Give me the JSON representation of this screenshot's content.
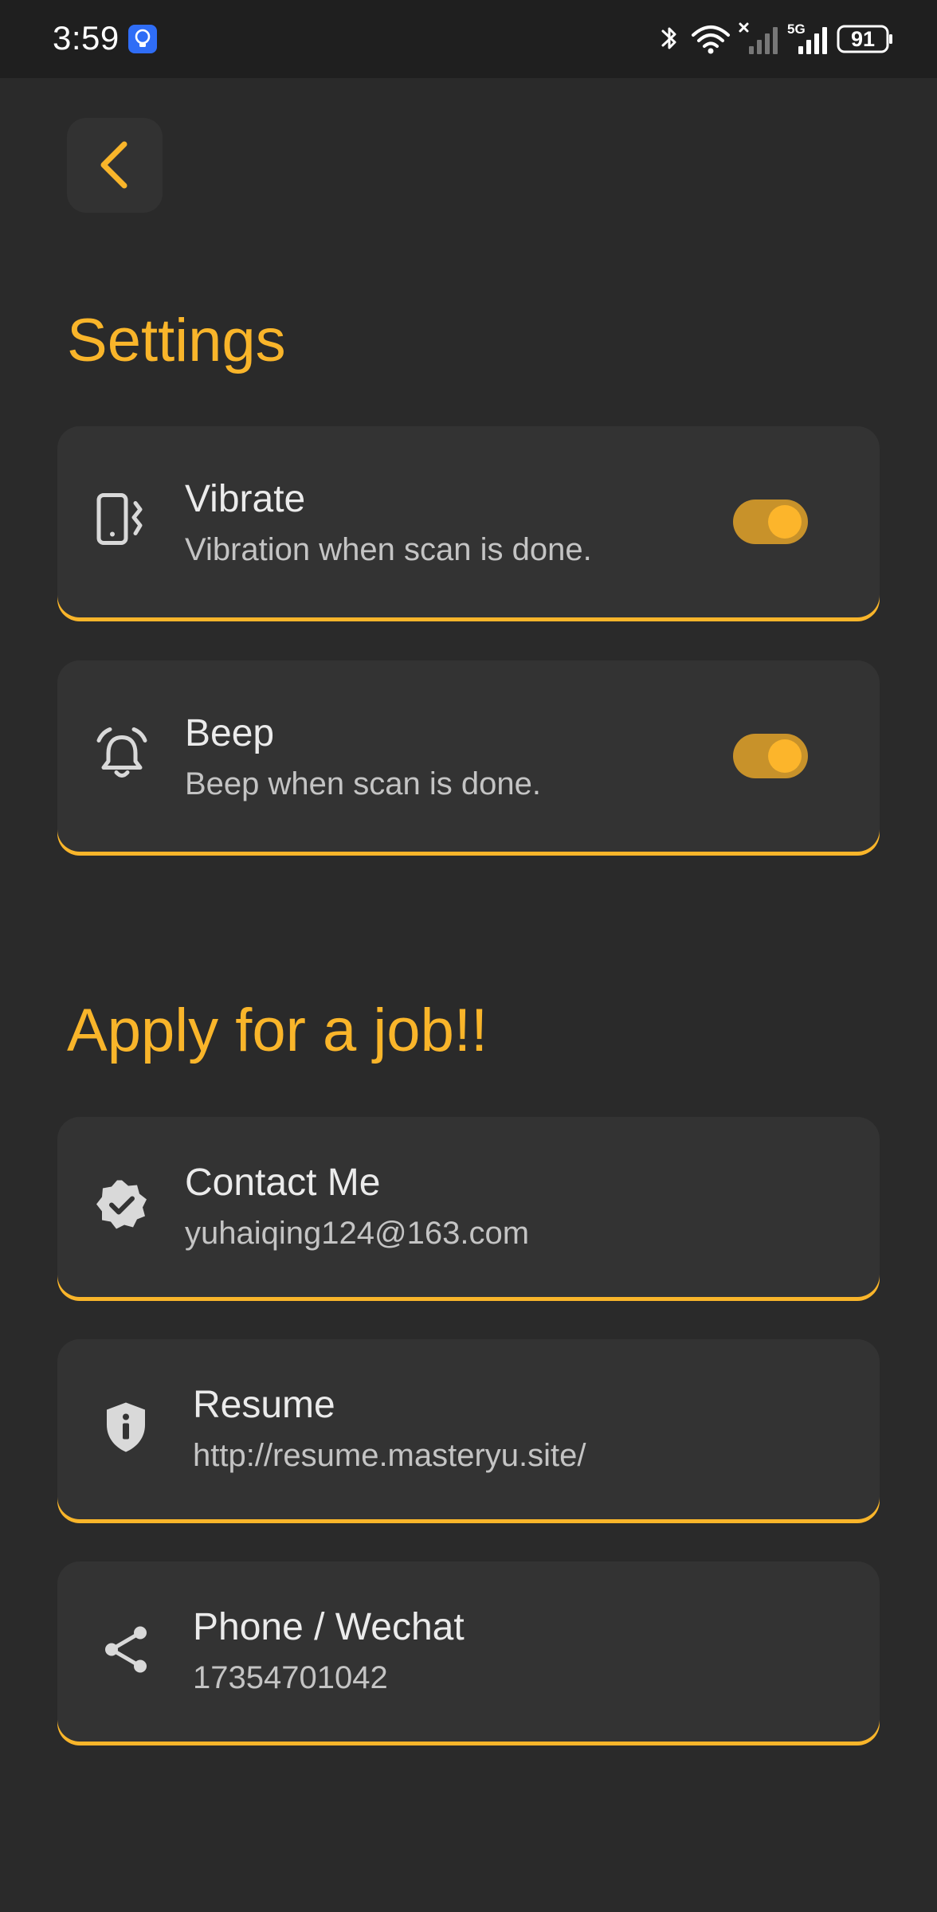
{
  "status_bar": {
    "time": "3:59",
    "battery": "91",
    "signal_label": "5G",
    "icons": [
      "app-notification-icon",
      "bluetooth-icon",
      "wifi-icon",
      "signal-off-icon",
      "signal-5g-icon",
      "battery-icon"
    ]
  },
  "nav": {
    "back_icon": "chevron-left-icon"
  },
  "settings": {
    "title": "Settings",
    "items": [
      {
        "icon": "phone-vibrate-icon",
        "title": "Vibrate",
        "subtitle": "Vibration when scan is done.",
        "enabled": true
      },
      {
        "icon": "alarm-bell-icon",
        "title": "Beep",
        "subtitle": "Beep when scan is done.",
        "enabled": true
      }
    ]
  },
  "apply": {
    "title": "Apply for a job!!",
    "items": [
      {
        "icon": "verified-badge-icon",
        "title": "Contact Me",
        "subtitle": "yuhaiqing124@163.com"
      },
      {
        "icon": "info-shield-icon",
        "title": "Resume",
        "subtitle": "http://resume.masteryu.site/"
      },
      {
        "icon": "share-icon",
        "title": "Phone / Wechat",
        "subtitle": "17354701042"
      }
    ]
  },
  "colors": {
    "accent": "#f9b52a",
    "background": "#2a2a2a",
    "card": "#333333",
    "toggle_track": "#c8922a"
  }
}
